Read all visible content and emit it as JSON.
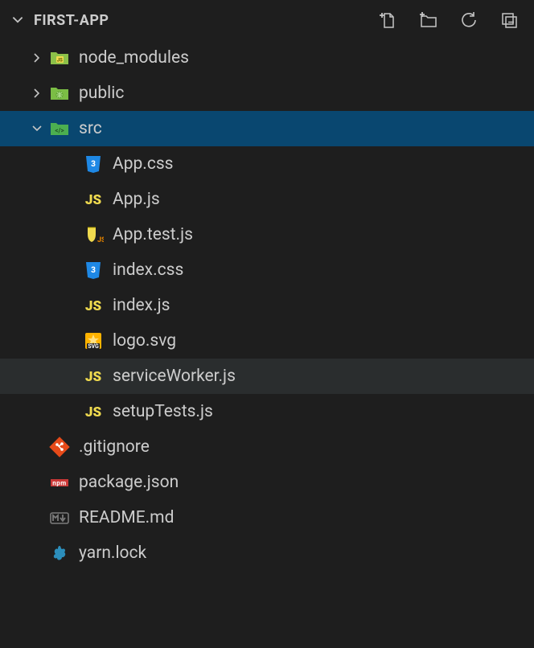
{
  "project_name": "FIRST-APP",
  "actions": {
    "new_file": "New File",
    "new_folder": "New Folder",
    "refresh": "Refresh",
    "collapse": "Collapse All"
  },
  "tree": [
    {
      "name": "node_modules",
      "type": "folder",
      "icon": "node-folder-icon",
      "depth": 1,
      "expanded": false
    },
    {
      "name": "public",
      "type": "folder",
      "icon": "public-folder-icon",
      "depth": 1,
      "expanded": false
    },
    {
      "name": "src",
      "type": "folder",
      "icon": "src-folder-icon",
      "depth": 1,
      "expanded": true,
      "selected": true
    },
    {
      "name": "App.css",
      "type": "file",
      "icon": "css-icon",
      "depth": 2
    },
    {
      "name": "App.js",
      "type": "file",
      "icon": "js-icon",
      "depth": 2
    },
    {
      "name": "App.test.js",
      "type": "file",
      "icon": "testjs-icon",
      "depth": 2
    },
    {
      "name": "index.css",
      "type": "file",
      "icon": "css-icon",
      "depth": 2
    },
    {
      "name": "index.js",
      "type": "file",
      "icon": "js-icon",
      "depth": 2
    },
    {
      "name": "logo.svg",
      "type": "file",
      "icon": "svg-icon",
      "depth": 2
    },
    {
      "name": "serviceWorker.js",
      "type": "file",
      "icon": "js-icon",
      "depth": 2,
      "hovered": true
    },
    {
      "name": "setupTests.js",
      "type": "file",
      "icon": "js-icon",
      "depth": 2
    },
    {
      "name": ".gitignore",
      "type": "file",
      "icon": "git-icon",
      "depth": 1
    },
    {
      "name": "package.json",
      "type": "file",
      "icon": "npm-icon",
      "depth": 1
    },
    {
      "name": "README.md",
      "type": "file",
      "icon": "md-icon",
      "depth": 1
    },
    {
      "name": "yarn.lock",
      "type": "file",
      "icon": "yarn-icon",
      "depth": 1
    }
  ],
  "colors": {
    "background": "#1e1e1e",
    "foreground": "#cccccc",
    "selection": "#094770",
    "hover": "#2a2d2e"
  }
}
